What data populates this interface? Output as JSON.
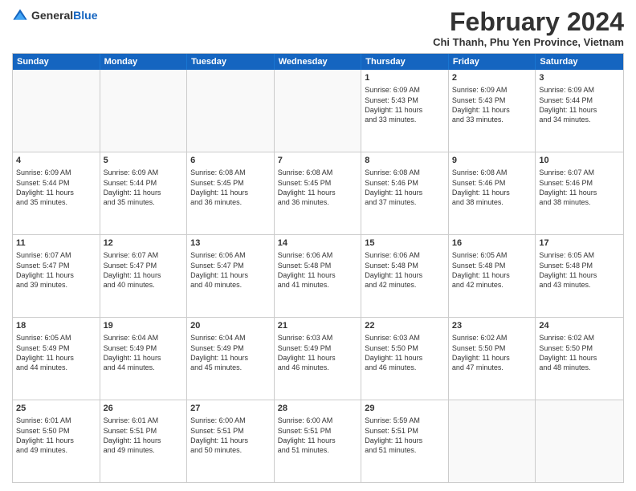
{
  "header": {
    "logo": {
      "general": "General",
      "blue": "Blue"
    },
    "title": "February 2024",
    "subtitle": "Chi Thanh, Phu Yen Province, Vietnam"
  },
  "calendar": {
    "days": [
      "Sunday",
      "Monday",
      "Tuesday",
      "Wednesday",
      "Thursday",
      "Friday",
      "Saturday"
    ],
    "weeks": [
      [
        {
          "day": "",
          "info": ""
        },
        {
          "day": "",
          "info": ""
        },
        {
          "day": "",
          "info": ""
        },
        {
          "day": "",
          "info": ""
        },
        {
          "day": "1",
          "info": "Sunrise: 6:09 AM\nSunset: 5:43 PM\nDaylight: 11 hours\nand 33 minutes."
        },
        {
          "day": "2",
          "info": "Sunrise: 6:09 AM\nSunset: 5:43 PM\nDaylight: 11 hours\nand 33 minutes."
        },
        {
          "day": "3",
          "info": "Sunrise: 6:09 AM\nSunset: 5:44 PM\nDaylight: 11 hours\nand 34 minutes."
        }
      ],
      [
        {
          "day": "4",
          "info": "Sunrise: 6:09 AM\nSunset: 5:44 PM\nDaylight: 11 hours\nand 35 minutes."
        },
        {
          "day": "5",
          "info": "Sunrise: 6:09 AM\nSunset: 5:44 PM\nDaylight: 11 hours\nand 35 minutes."
        },
        {
          "day": "6",
          "info": "Sunrise: 6:08 AM\nSunset: 5:45 PM\nDaylight: 11 hours\nand 36 minutes."
        },
        {
          "day": "7",
          "info": "Sunrise: 6:08 AM\nSunset: 5:45 PM\nDaylight: 11 hours\nand 36 minutes."
        },
        {
          "day": "8",
          "info": "Sunrise: 6:08 AM\nSunset: 5:46 PM\nDaylight: 11 hours\nand 37 minutes."
        },
        {
          "day": "9",
          "info": "Sunrise: 6:08 AM\nSunset: 5:46 PM\nDaylight: 11 hours\nand 38 minutes."
        },
        {
          "day": "10",
          "info": "Sunrise: 6:07 AM\nSunset: 5:46 PM\nDaylight: 11 hours\nand 38 minutes."
        }
      ],
      [
        {
          "day": "11",
          "info": "Sunrise: 6:07 AM\nSunset: 5:47 PM\nDaylight: 11 hours\nand 39 minutes."
        },
        {
          "day": "12",
          "info": "Sunrise: 6:07 AM\nSunset: 5:47 PM\nDaylight: 11 hours\nand 40 minutes."
        },
        {
          "day": "13",
          "info": "Sunrise: 6:06 AM\nSunset: 5:47 PM\nDaylight: 11 hours\nand 40 minutes."
        },
        {
          "day": "14",
          "info": "Sunrise: 6:06 AM\nSunset: 5:48 PM\nDaylight: 11 hours\nand 41 minutes."
        },
        {
          "day": "15",
          "info": "Sunrise: 6:06 AM\nSunset: 5:48 PM\nDaylight: 11 hours\nand 42 minutes."
        },
        {
          "day": "16",
          "info": "Sunrise: 6:05 AM\nSunset: 5:48 PM\nDaylight: 11 hours\nand 42 minutes."
        },
        {
          "day": "17",
          "info": "Sunrise: 6:05 AM\nSunset: 5:48 PM\nDaylight: 11 hours\nand 43 minutes."
        }
      ],
      [
        {
          "day": "18",
          "info": "Sunrise: 6:05 AM\nSunset: 5:49 PM\nDaylight: 11 hours\nand 44 minutes."
        },
        {
          "day": "19",
          "info": "Sunrise: 6:04 AM\nSunset: 5:49 PM\nDaylight: 11 hours\nand 44 minutes."
        },
        {
          "day": "20",
          "info": "Sunrise: 6:04 AM\nSunset: 5:49 PM\nDaylight: 11 hours\nand 45 minutes."
        },
        {
          "day": "21",
          "info": "Sunrise: 6:03 AM\nSunset: 5:49 PM\nDaylight: 11 hours\nand 46 minutes."
        },
        {
          "day": "22",
          "info": "Sunrise: 6:03 AM\nSunset: 5:50 PM\nDaylight: 11 hours\nand 46 minutes."
        },
        {
          "day": "23",
          "info": "Sunrise: 6:02 AM\nSunset: 5:50 PM\nDaylight: 11 hours\nand 47 minutes."
        },
        {
          "day": "24",
          "info": "Sunrise: 6:02 AM\nSunset: 5:50 PM\nDaylight: 11 hours\nand 48 minutes."
        }
      ],
      [
        {
          "day": "25",
          "info": "Sunrise: 6:01 AM\nSunset: 5:50 PM\nDaylight: 11 hours\nand 49 minutes."
        },
        {
          "day": "26",
          "info": "Sunrise: 6:01 AM\nSunset: 5:51 PM\nDaylight: 11 hours\nand 49 minutes."
        },
        {
          "day": "27",
          "info": "Sunrise: 6:00 AM\nSunset: 5:51 PM\nDaylight: 11 hours\nand 50 minutes."
        },
        {
          "day": "28",
          "info": "Sunrise: 6:00 AM\nSunset: 5:51 PM\nDaylight: 11 hours\nand 51 minutes."
        },
        {
          "day": "29",
          "info": "Sunrise: 5:59 AM\nSunset: 5:51 PM\nDaylight: 11 hours\nand 51 minutes."
        },
        {
          "day": "",
          "info": ""
        },
        {
          "day": "",
          "info": ""
        }
      ]
    ]
  }
}
